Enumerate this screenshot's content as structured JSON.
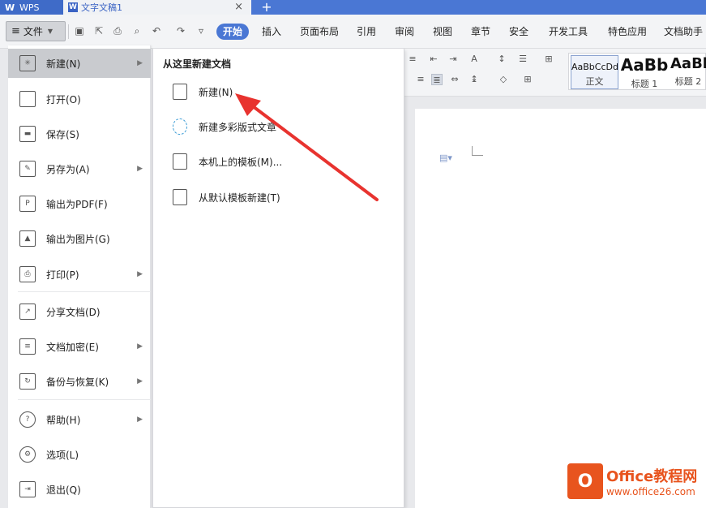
{
  "tabs": {
    "app_label": "WPS",
    "doc_label": "文字文稿1",
    "close_glyph": "×",
    "add_glyph": "+"
  },
  "menubar": {
    "file_label": "文件",
    "items": [
      "开始",
      "插入",
      "页面布局",
      "引用",
      "审阅",
      "视图",
      "章节",
      "安全",
      "开发工具",
      "特色应用",
      "文档助手"
    ],
    "active_index": 0
  },
  "styles": [
    {
      "sample": "AaBbCcDd",
      "name": "正文"
    },
    {
      "sample": "AaBb",
      "name": "标题 1"
    },
    {
      "sample": "AaBb",
      "name": "标题 2"
    }
  ],
  "file_menu": {
    "items": [
      {
        "label": "新建(N)",
        "icon": "new-doc-icon",
        "has_sub": true,
        "active": true
      },
      {
        "label": "打开(O)",
        "icon": "folder-icon",
        "has_sub": false
      },
      {
        "label": "保存(S)",
        "icon": "save-icon",
        "has_sub": false
      },
      {
        "label": "另存为(A)",
        "icon": "save-as-icon",
        "has_sub": true
      },
      {
        "label": "输出为PDF(F)",
        "icon": "pdf-icon",
        "has_sub": false
      },
      {
        "label": "输出为图片(G)",
        "icon": "image-export-icon",
        "has_sub": false
      },
      {
        "label": "打印(P)",
        "icon": "printer-icon",
        "has_sub": true
      },
      {
        "label": "分享文档(D)",
        "icon": "share-icon",
        "has_sub": false
      },
      {
        "label": "文档加密(E)",
        "icon": "encrypt-icon",
        "has_sub": true
      },
      {
        "label": "备份与恢复(K)",
        "icon": "backup-icon",
        "has_sub": true
      },
      {
        "label": "帮助(H)",
        "icon": "help-icon",
        "has_sub": true
      },
      {
        "label": "选项(L)",
        "icon": "gear-icon",
        "has_sub": false
      },
      {
        "label": "退出(Q)",
        "icon": "exit-icon",
        "has_sub": false
      }
    ]
  },
  "submenu": {
    "title": "从这里新建文档",
    "items": [
      {
        "label": "新建(N)",
        "icon": "new-doc-icon"
      },
      {
        "label": "新建多彩版式文章",
        "icon": "colorful-doc-icon"
      },
      {
        "label": "本机上的模板(M)...",
        "icon": "local-template-icon"
      },
      {
        "label": "从默认模板新建(T)",
        "icon": "default-template-icon"
      }
    ]
  },
  "watermark": {
    "brand": "Office教程网",
    "url": "www.office26.com",
    "logo_glyph": "O"
  },
  "colors": {
    "accent": "#4a77d4",
    "arrow": "#e8332f",
    "watermark": "#e8541e"
  }
}
